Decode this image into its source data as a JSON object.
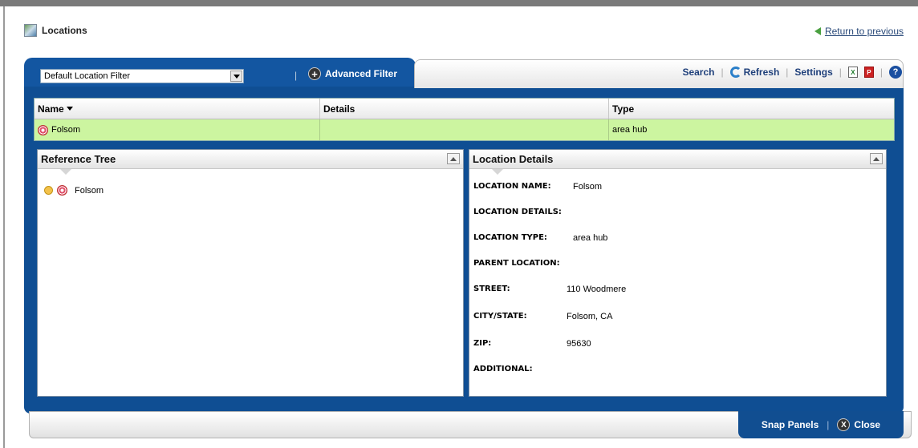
{
  "page": {
    "title": "Locations",
    "return_link": "Return to previous"
  },
  "filter": {
    "selected": "Default Location Filter",
    "advanced_label": "Advanced Filter"
  },
  "toolbar": {
    "search": "Search",
    "refresh": "Refresh",
    "settings": "Settings",
    "excel_icon": "excel-icon",
    "pdf_icon": "pdf-icon",
    "help_icon": "help-icon"
  },
  "table": {
    "columns": [
      "Name",
      "Details",
      "Type"
    ],
    "rows": [
      {
        "name": "Folsom",
        "details": "",
        "type": "area hub"
      }
    ]
  },
  "reference_tree": {
    "title": "Reference Tree",
    "nodes": [
      {
        "label": "Folsom"
      }
    ]
  },
  "location_details": {
    "title": "Location Details",
    "fields": [
      {
        "label": "LOCATION NAME:",
        "value": "Folsom"
      },
      {
        "label": "LOCATION DETAILS:",
        "value": ""
      },
      {
        "label": "LOCATION TYPE:",
        "value": "area hub"
      },
      {
        "label": "PARENT LOCATION:",
        "value": ""
      },
      {
        "label": "STREET:",
        "value": "110 Woodmere"
      },
      {
        "label": "CITY/STATE:",
        "value": "Folsom, CA"
      },
      {
        "label": "ZIP:",
        "value": "95630"
      },
      {
        "label": "ADDITIONAL:",
        "value": ""
      }
    ]
  },
  "footer": {
    "snap_panels": "Snap Panels",
    "separator": "|",
    "close": "Close"
  },
  "colors": {
    "panel_blue": "#0f4e93",
    "selected_row": "#ccf5a0"
  }
}
